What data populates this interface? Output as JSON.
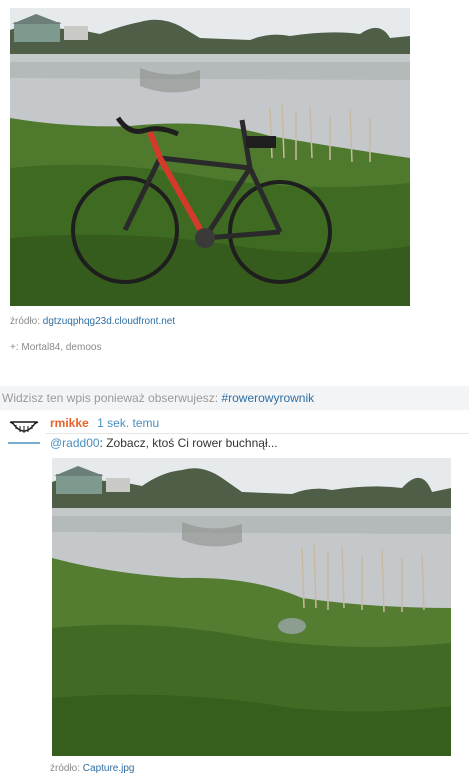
{
  "post1": {
    "source_label": "źródło:",
    "source_link": "dgtzuqphqg23d.cloudfront.net",
    "plus_prefix": "+:",
    "plus_names": "Mortal84, demoos"
  },
  "observe": {
    "text": "Widzisz ten wpis ponieważ obserwujesz:",
    "tag": "#rowerowyrownik"
  },
  "comment": {
    "author": "rmikke",
    "time": "1 sek. temu",
    "mention": "@radd00",
    "text": ": Zobacz, ktoś Ci rower buchnął...",
    "source_label": "źródło:",
    "source_link": "Capture.jpg"
  },
  "colors": {
    "author": "#e8622a",
    "link": "#2f6fa3",
    "time": "#4a8fc0",
    "observe_bg": "#f3f4f6"
  },
  "icons": {
    "avatar": "smiley-avatar-icon"
  }
}
